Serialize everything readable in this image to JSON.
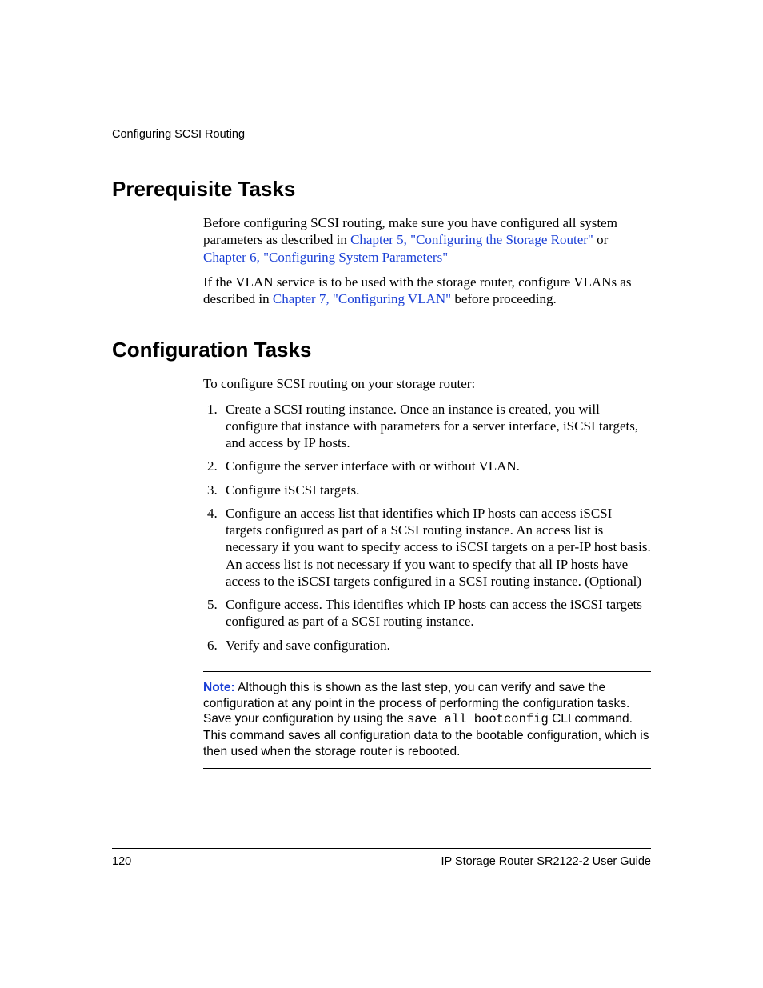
{
  "header": {
    "running_title": "Configuring SCSI Routing"
  },
  "sections": {
    "prereq": {
      "title": "Prerequisite Tasks",
      "para1_pre": "Before configuring SCSI routing, make sure you have configured all system parameters as described in ",
      "para1_link1": "Chapter 5, \"Configuring the Storage Router\"",
      "para1_mid": " or ",
      "para1_link2": "Chapter 6, \"Configuring System Parameters\"",
      "para2_pre": "If the VLAN service is to be used with the storage router, configure VLANs as described in ",
      "para2_link": "Chapter 7, \"Configuring VLAN\"",
      "para2_post": " before proceeding."
    },
    "config": {
      "title": "Configuration Tasks",
      "intro": "To configure SCSI routing on your storage router:",
      "steps": [
        "Create a SCSI routing instance. Once an instance is created, you will configure that instance with parameters for a server interface, iSCSI targets, and access by IP hosts.",
        "Configure the server interface with or without VLAN.",
        "Configure iSCSI targets.",
        "Configure an access list that identifies which IP hosts can access iSCSI targets configured as part of a SCSI routing instance. An access list is necessary if you want to specify access to iSCSI targets on a per-IP host basis. An access list is not necessary if you want to specify that all IP hosts have access to the iSCSI targets configured in a SCSI routing instance. (Optional)",
        "Configure access. This identifies which IP hosts can access the iSCSI targets configured as part of a SCSI routing instance.",
        "Verify and save configuration."
      ],
      "note_label": "Note:",
      "note_pre": "  Although this is shown as the last step, you can verify and save the configuration at any point in the process of performing the configuration tasks. Save your configuration by using the ",
      "note_code": "save all bootconfig",
      "note_post": " CLI command. This command saves all configuration data to the bootable configuration, which is then used when the storage router is rebooted."
    }
  },
  "footer": {
    "page_number": "120",
    "doc_title": "IP Storage Router SR2122-2 User Guide"
  }
}
